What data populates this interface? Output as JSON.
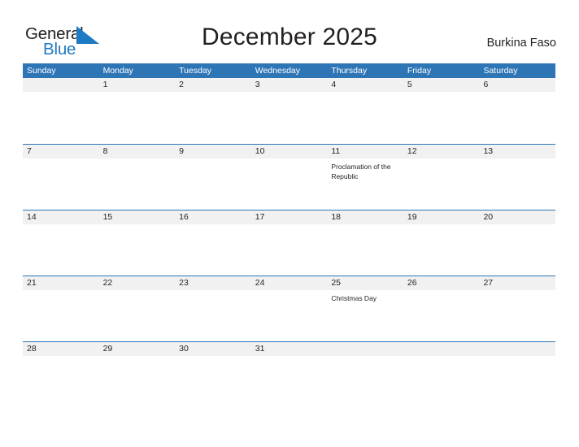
{
  "branding": {
    "logo_word_1": "General",
    "logo_word_2": "Blue",
    "logo_icon": "flag-triangle-icon",
    "logo_color_primary": "#231f20",
    "logo_color_accent": "#1f7ac4"
  },
  "header": {
    "title": "December 2025",
    "country": "Burkina Faso"
  },
  "colors": {
    "header_blue": "#2e75b6",
    "row_band_gray": "#f1f1f1",
    "text": "#231f20",
    "header_text": "#ffffff"
  },
  "calendar": {
    "month": "December",
    "year": "2025",
    "weekday_headers": [
      "Sunday",
      "Monday",
      "Tuesday",
      "Wednesday",
      "Thursday",
      "Friday",
      "Saturday"
    ],
    "weeks": [
      {
        "days": [
          {
            "number": "",
            "events": []
          },
          {
            "number": "1",
            "events": []
          },
          {
            "number": "2",
            "events": []
          },
          {
            "number": "3",
            "events": []
          },
          {
            "number": "4",
            "events": []
          },
          {
            "number": "5",
            "events": []
          },
          {
            "number": "6",
            "events": []
          }
        ]
      },
      {
        "days": [
          {
            "number": "7",
            "events": []
          },
          {
            "number": "8",
            "events": []
          },
          {
            "number": "9",
            "events": []
          },
          {
            "number": "10",
            "events": []
          },
          {
            "number": "11",
            "events": [
              "Proclamation of the Republic"
            ]
          },
          {
            "number": "12",
            "events": []
          },
          {
            "number": "13",
            "events": []
          }
        ]
      },
      {
        "days": [
          {
            "number": "14",
            "events": []
          },
          {
            "number": "15",
            "events": []
          },
          {
            "number": "16",
            "events": []
          },
          {
            "number": "17",
            "events": []
          },
          {
            "number": "18",
            "events": []
          },
          {
            "number": "19",
            "events": []
          },
          {
            "number": "20",
            "events": []
          }
        ]
      },
      {
        "days": [
          {
            "number": "21",
            "events": []
          },
          {
            "number": "22",
            "events": []
          },
          {
            "number": "23",
            "events": []
          },
          {
            "number": "24",
            "events": []
          },
          {
            "number": "25",
            "events": [
              "Christmas Day"
            ]
          },
          {
            "number": "26",
            "events": []
          },
          {
            "number": "27",
            "events": []
          }
        ]
      },
      {
        "days": [
          {
            "number": "28",
            "events": []
          },
          {
            "number": "29",
            "events": []
          },
          {
            "number": "30",
            "events": []
          },
          {
            "number": "31",
            "events": []
          },
          {
            "number": "",
            "events": []
          },
          {
            "number": "",
            "events": []
          },
          {
            "number": "",
            "events": []
          }
        ]
      }
    ]
  }
}
